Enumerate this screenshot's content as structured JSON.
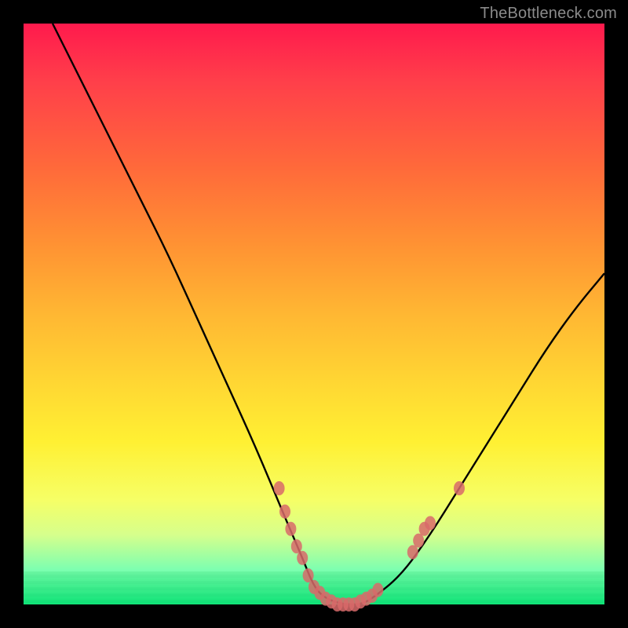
{
  "watermark": "TheBottleneck.com",
  "colors": {
    "background": "#000000",
    "gradient_top": "#ff1a4d",
    "gradient_mid1": "#ff9233",
    "gradient_mid2": "#ffe433",
    "gradient_bottom": "#00e676",
    "curve": "#000000",
    "markers": "#d86a6a"
  },
  "chart_data": {
    "type": "line",
    "title": "",
    "xlabel": "",
    "ylabel": "",
    "xlim": [
      0,
      100
    ],
    "ylim": [
      0,
      100
    ],
    "series": [
      {
        "name": "curve",
        "x": [
          5,
          10,
          15,
          20,
          25,
          30,
          35,
          40,
          45,
          48,
          50,
          52,
          55,
          58,
          60,
          65,
          70,
          75,
          80,
          85,
          90,
          95,
          100
        ],
        "y": [
          100,
          90,
          80,
          70,
          60,
          49,
          38,
          27,
          15,
          8,
          3,
          1,
          0,
          0,
          1,
          5,
          12,
          20,
          28,
          36,
          44,
          51,
          57
        ]
      }
    ],
    "markers": [
      {
        "x": 44,
        "y": 20
      },
      {
        "x": 45,
        "y": 16
      },
      {
        "x": 46,
        "y": 13
      },
      {
        "x": 47,
        "y": 10
      },
      {
        "x": 48,
        "y": 8
      },
      {
        "x": 49,
        "y": 5
      },
      {
        "x": 50,
        "y": 3
      },
      {
        "x": 51,
        "y": 2
      },
      {
        "x": 52,
        "y": 1
      },
      {
        "x": 53,
        "y": 0.5
      },
      {
        "x": 54,
        "y": 0
      },
      {
        "x": 55,
        "y": 0
      },
      {
        "x": 56,
        "y": 0
      },
      {
        "x": 57,
        "y": 0
      },
      {
        "x": 58,
        "y": 0.5
      },
      {
        "x": 59,
        "y": 1
      },
      {
        "x": 60,
        "y": 1.5
      },
      {
        "x": 61,
        "y": 2.5
      },
      {
        "x": 67,
        "y": 9
      },
      {
        "x": 68,
        "y": 11
      },
      {
        "x": 69,
        "y": 13
      },
      {
        "x": 70,
        "y": 14
      },
      {
        "x": 75,
        "y": 20
      }
    ]
  }
}
